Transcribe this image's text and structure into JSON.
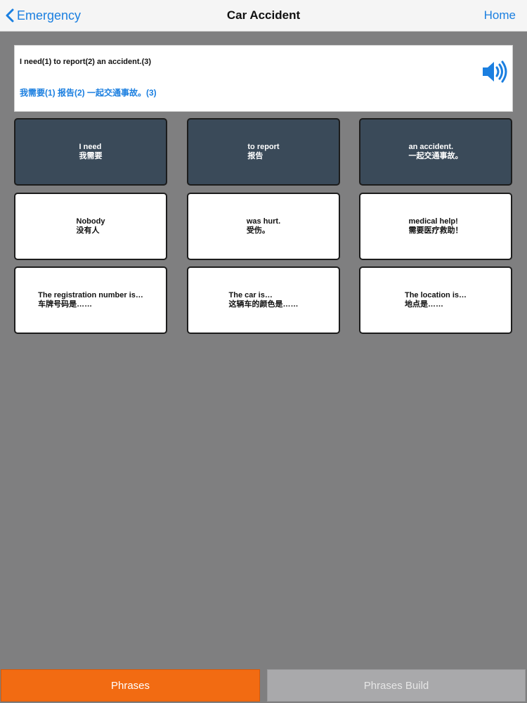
{
  "nav": {
    "back_label": "Emergency",
    "title": "Car Accident",
    "home_label": "Home"
  },
  "sentence": {
    "english": "I need(1) to report(2) an accident.(3)",
    "chinese": "我需要(1) 报告(2) 一起交通事故。(3)"
  },
  "cards": [
    {
      "en": "I need",
      "zh": "我需要",
      "selected": true
    },
    {
      "en": "to report",
      "zh": "报告",
      "selected": true
    },
    {
      "en": "an accident.",
      "zh": "一起交通事故。",
      "selected": true
    },
    {
      "en": "Nobody",
      "zh": "没有人",
      "selected": false
    },
    {
      "en": "was hurt.",
      "zh": "受伤。",
      "selected": false
    },
    {
      "en": "medical help!",
      "zh": "需要医疗救助！",
      "selected": false
    },
    {
      "en": "The registration number is…",
      "zh": "车牌号码是……",
      "selected": false
    },
    {
      "en": "The car is…",
      "zh": "这辆车的颜色是……",
      "selected": false
    },
    {
      "en": "The location is…",
      "zh": "地点是……",
      "selected": false
    }
  ],
  "tabs": [
    {
      "label": "Phrases",
      "active": true
    },
    {
      "label": "Phrases Build",
      "active": false
    }
  ],
  "colors": {
    "accent": "#1b7fe0",
    "active_tab": "#f26b12",
    "selected_card": "#3a4a59",
    "background": "#7f7f80"
  }
}
